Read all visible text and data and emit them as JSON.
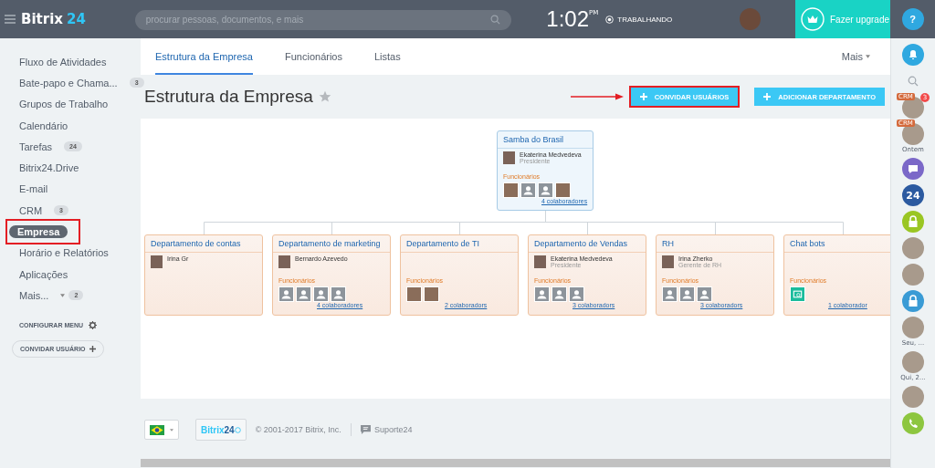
{
  "header": {
    "logo_text": "Bitrix",
    "logo_number": "24",
    "search": {
      "placeholder": "procurar pessoas, documentos, e mais"
    },
    "time": "1:02",
    "meridiem": "PM",
    "status": "TRABALHANDO",
    "upgrade": "Fazer upgrade",
    "help": "?"
  },
  "sidebar": {
    "items": [
      {
        "label": "Fluxo de Atividades",
        "selected": false,
        "annotated": false
      },
      {
        "label": "Bate-papo e Chama...",
        "badge": "3",
        "selected": false,
        "annotated": false
      },
      {
        "label": "Grupos de Trabalho",
        "selected": false,
        "annotated": false
      },
      {
        "label": "Calendário",
        "selected": false,
        "annotated": false
      },
      {
        "label": "Tarefas",
        "badge": "24",
        "selected": false,
        "annotated": false
      },
      {
        "label": "Bitrix24.Drive",
        "selected": false,
        "annotated": false
      },
      {
        "label": "E-mail",
        "selected": false,
        "annotated": false
      },
      {
        "label": "CRM",
        "badge": "3",
        "selected": false,
        "annotated": false
      },
      {
        "label": "Empresa",
        "selected": true,
        "annotated": true
      },
      {
        "label": "Horário e Relatórios",
        "selected": false,
        "annotated": false
      },
      {
        "label": "Aplicações",
        "selected": false,
        "annotated": false
      },
      {
        "label": "Mais...",
        "badge": "2",
        "caret": true,
        "selected": false,
        "annotated": false
      }
    ],
    "configure": "CONFIGURAR MENU",
    "invite": "CONVIDAR USUÁRIO"
  },
  "tabs": [
    {
      "label": "Estrutura da Empresa",
      "selected": true
    },
    {
      "label": "Funcionários",
      "selected": false
    },
    {
      "label": "Listas",
      "selected": false
    }
  ],
  "more": "Mais",
  "page_title": "Estrutura da Empresa",
  "buttons": [
    {
      "label": "CONVIDAR USUÁRIOS",
      "annotated": true
    },
    {
      "label": "ADICIONAR DEPARTAMENTO",
      "annotated": false
    }
  ],
  "org": {
    "root": {
      "title": "Samba do Brasil",
      "head": {
        "name": "Ekaterina Medvedeva",
        "role": "Presidente"
      },
      "employees_label": "Funcionários",
      "employees": [
        {
          "kind": "photo"
        },
        {
          "kind": "placeholder"
        },
        {
          "kind": "placeholder"
        },
        {
          "kind": "photo"
        }
      ],
      "link": "4 colaboradores"
    },
    "departments": [
      {
        "title": "Departamento de contas",
        "head": {
          "name": "Irina Gr"
        }
      },
      {
        "title": "Departamento de marketing",
        "head": {
          "name": "Bernardo Azevedo"
        },
        "employees_label": "Funcionários",
        "employees": [
          {
            "kind": "placeholder"
          },
          {
            "kind": "placeholder"
          },
          {
            "kind": "placeholder"
          },
          {
            "kind": "placeholder"
          }
        ],
        "link": "4 colaboradores"
      },
      {
        "title": "Departamento de TI",
        "employees_label": "Funcionários",
        "employees": [
          {
            "kind": "photo"
          },
          {
            "kind": "photo"
          }
        ],
        "link": "2 colaboradors"
      },
      {
        "title": "Departamento de Vendas",
        "head": {
          "name": "Ekaterina Medvedeva",
          "role": "Presidente"
        },
        "employees_label": "Funcionários",
        "employees": [
          {
            "kind": "placeholder"
          },
          {
            "kind": "placeholder"
          },
          {
            "kind": "placeholder"
          }
        ],
        "link": "3 colaboradors"
      },
      {
        "title": "RH",
        "head": {
          "name": "Irina Zherko",
          "role": "Gerente de RH"
        },
        "employees_label": "Funcionários",
        "employees": [
          {
            "kind": "placeholder"
          },
          {
            "kind": "placeholder"
          },
          {
            "kind": "placeholder"
          }
        ],
        "link": "3 colaboradors"
      },
      {
        "title": "Chat bots",
        "employees_label": "Funcionários",
        "employees": [
          {
            "kind": "bot"
          }
        ],
        "link": "1 colaborador"
      }
    ]
  },
  "footer": {
    "brand": "Bitrix",
    "brand_number": "24",
    "copyright": "© 2001-2017 Bitrix, Inc.",
    "support": "Suporte24"
  },
  "right_bar": [
    {
      "kind": "bell"
    },
    {
      "kind": "search"
    },
    {
      "kind": "avatar",
      "tag": "CRM",
      "badge": "3"
    },
    {
      "kind": "avatar",
      "tag": "CRM",
      "caption": "Ontem"
    },
    {
      "kind": "chat",
      "color": "#7b68c8"
    },
    {
      "kind": "logo",
      "text": "24",
      "color": "#2c5aa0"
    },
    {
      "kind": "lock",
      "color": "#9ac623"
    },
    {
      "kind": "avatar"
    },
    {
      "kind": "avatar"
    },
    {
      "kind": "lock",
      "color": "#3a9bd5"
    },
    {
      "kind": "avatar",
      "caption": "Seu, ..."
    },
    {
      "kind": "avatar",
      "caption": "Qui, 2..."
    },
    {
      "kind": "avatar"
    },
    {
      "kind": "phone",
      "color": "#8dc63f"
    }
  ]
}
